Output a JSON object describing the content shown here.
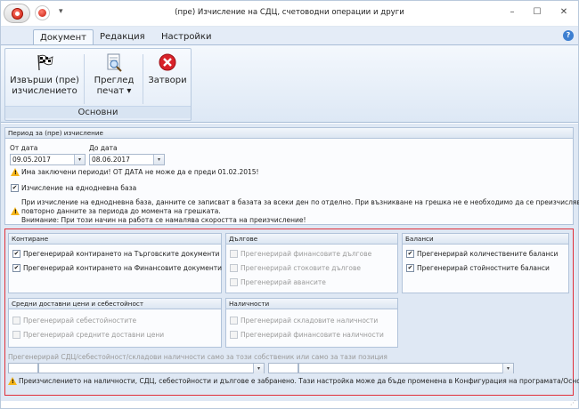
{
  "window": {
    "title": "(пре) Изчисление на СДЦ, счетоводни операции и други",
    "minimize": "–",
    "maximize": "☐",
    "close": "✕"
  },
  "tabs": [
    "Документ",
    "Редакция",
    "Настройки"
  ],
  "ribbon": {
    "buttons": {
      "execute_line1": "Извърши (пре)",
      "execute_line2": "изчислението",
      "preview_line1": "Преглед",
      "preview_line2": "печат ▾",
      "close": "Затвори"
    },
    "group_label": "Основни"
  },
  "period": {
    "header": "Период за (пре) изчисление",
    "from_label": "От дата",
    "from_value": "09.05.2017",
    "to_label": "До дата",
    "to_value": "08.06.2017",
    "warning": "Има заключени периоди! ОТ ДАТА не може да е преди 01.02.2015!",
    "daily_base_label": "Изчисление на еднодневна база",
    "daily_base_checked": true,
    "info_line1": "При изчисление на еднодневна база, данните се записват в базата за всеки ден по отделно. При възникване на грешка не е необходимо да се преизчислявт",
    "info_line2": "повторно данните за периода до момента на грешката.",
    "info_line3": "Внимание: При този начин на работа се намалява скоростта на преизчисление!"
  },
  "sections": {
    "kontirane": {
      "header": "Контиране",
      "items": [
        {
          "label": "Прегенерирай контирането на Търговските документи",
          "checked": true
        },
        {
          "label": "Прегенерирай контирането на Финансовите документи",
          "checked": true
        }
      ]
    },
    "dalgove": {
      "header": "Дългове",
      "items": [
        {
          "label": "Прегенерирай финансовите дългове",
          "checked": false
        },
        {
          "label": "Прегенерирай стоковите дългове",
          "checked": false
        },
        {
          "label": "Прегенерирай авансите",
          "checked": false
        }
      ]
    },
    "balansi": {
      "header": "Баланси",
      "items": [
        {
          "label": "Прегенерирай количествените баланси",
          "checked": true
        },
        {
          "label": "Прегенерирай стойностните баланси",
          "checked": true
        }
      ]
    },
    "sredni": {
      "header": "Средни доставни цени и себестойност",
      "items": [
        {
          "label": "Прегенерирай себестойностите",
          "checked": false
        },
        {
          "label": "Прегенерирай средните доставни цени",
          "checked": false
        }
      ]
    },
    "nalichnosti": {
      "header": "Наличности",
      "items": [
        {
          "label": "Прегенерирай складовите наличности",
          "checked": false
        },
        {
          "label": "Прегенерирай финансовите наличности",
          "checked": false
        }
      ]
    }
  },
  "owner_filter_label": "Прегенерирай СДЦ/себестойност/складови наличности само за този собственик или само за тази позиция",
  "footer_warning": "Преизчислението на наличности, СДЦ, себестойности и дългове е забранено. Тази настройка може да бъде променена в Конфигурация на програмата/Основни.",
  "colors": {
    "accent": "#e0303a",
    "panel_border": "#b1c3da",
    "background": "#dfe8f4"
  }
}
